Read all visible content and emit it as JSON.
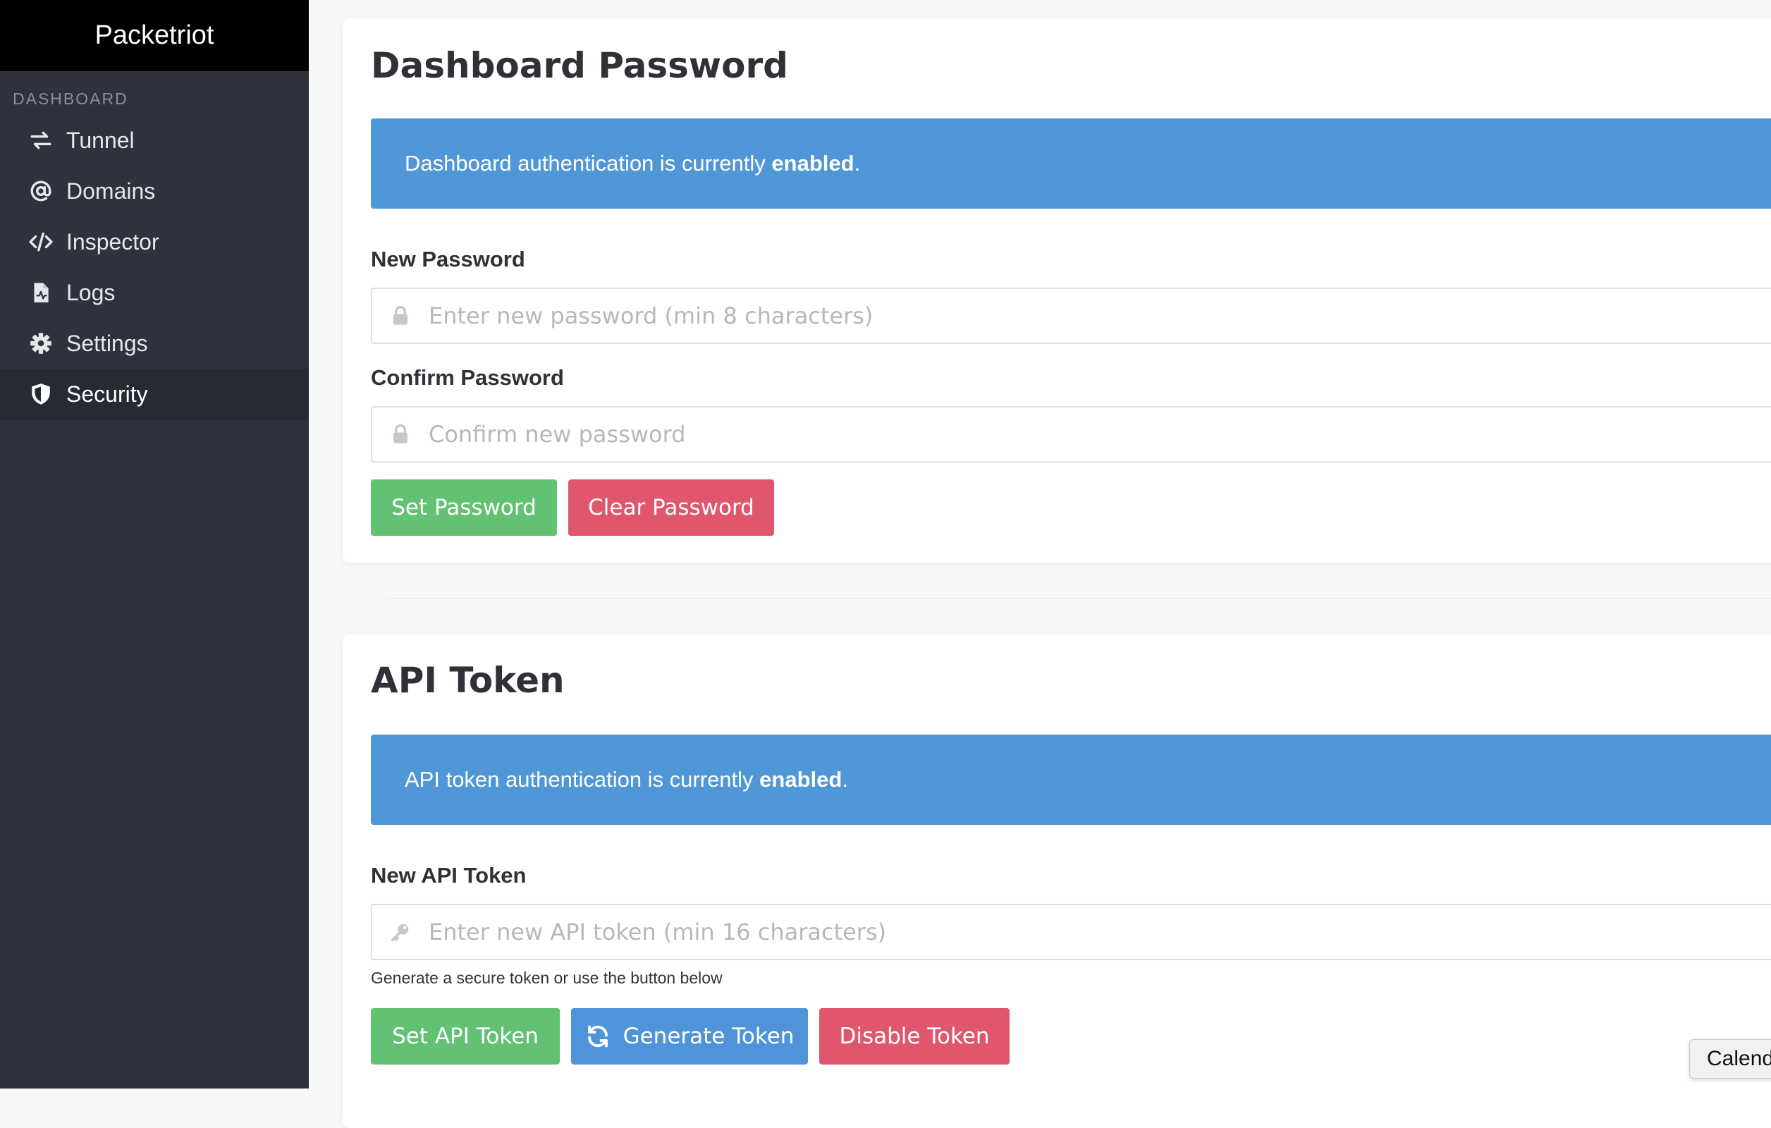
{
  "sidebar": {
    "brand": "Packetriot",
    "section_label": "DASHBOARD",
    "items": [
      {
        "label": "Tunnel",
        "icon": "exchange-arrows-icon"
      },
      {
        "label": "Domains",
        "icon": "at-sign-icon"
      },
      {
        "label": "Inspector",
        "icon": "code-icon"
      },
      {
        "label": "Logs",
        "icon": "file-chart-icon"
      },
      {
        "label": "Settings",
        "icon": "gear-icon"
      },
      {
        "label": "Security",
        "icon": "shield-icon",
        "active": true
      }
    ]
  },
  "password_section": {
    "title": "Dashboard Password",
    "alert_prefix": "Dashboard authentication is currently",
    "alert_status": "enabled",
    "alert_suffix": ".",
    "new_password_label": "New Password",
    "new_password_placeholder": "Enter new password (min 8 characters)",
    "confirm_password_label": "Confirm Password",
    "confirm_password_placeholder": "Confirm new password",
    "set_button": "Set Password",
    "clear_button": "Clear Password"
  },
  "token_section": {
    "title": "API Token",
    "alert_prefix": "API token authentication is currently",
    "alert_status": "enabled",
    "alert_suffix": ".",
    "new_token_label": "New API Token",
    "new_token_placeholder": "Enter new API token (min 16 characters)",
    "help_text": "Generate a secure token or use the button below",
    "set_button": "Set API Token",
    "generate_button": "Generate Token",
    "disable_button": "Disable Token"
  },
  "tooltip": {
    "text": "Calend"
  },
  "colors": {
    "sidebar_bg": "#2e323d",
    "brand_bg": "#000000",
    "alert_blue": "#5097d8",
    "success_green": "#62c173",
    "danger_red": "#e0566d",
    "primary_blue": "#4f94d9"
  }
}
